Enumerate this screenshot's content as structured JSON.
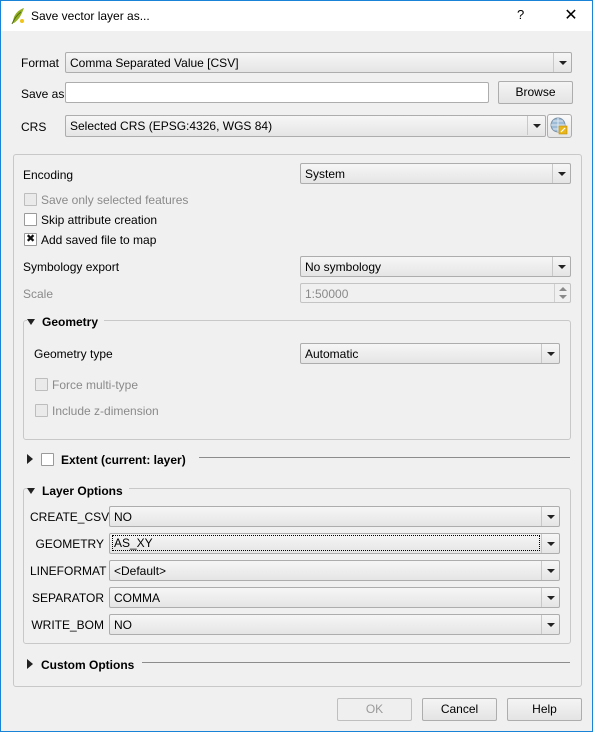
{
  "window": {
    "title": "Save vector layer as...",
    "help_label": "?",
    "close_label": "✕"
  },
  "top": {
    "format_label": "Format",
    "format_value": "Comma Separated Value [CSV]",
    "save_as_label": "Save as",
    "save_as_value": "",
    "browse_label": "Browse",
    "crs_label": "CRS",
    "crs_value": "Selected CRS (EPSG:4326, WGS 84)"
  },
  "options": {
    "encoding_label": "Encoding",
    "encoding_value": "System",
    "save_selected_label": "Save only selected features",
    "save_selected_checked": false,
    "skip_attr_label": "Skip attribute creation",
    "skip_attr_checked": false,
    "add_to_map_label": "Add saved file to map",
    "add_to_map_checked": true,
    "symbology_label": "Symbology export",
    "symbology_value": "No symbology",
    "scale_label": "Scale",
    "scale_value": "1:50000"
  },
  "geometry": {
    "title": "Geometry",
    "type_label": "Geometry type",
    "type_value": "Automatic",
    "force_multi_label": "Force multi-type",
    "include_z_label": "Include z-dimension"
  },
  "extent": {
    "title": "Extent (current: layer)",
    "checked": false
  },
  "layer_options": {
    "title": "Layer Options",
    "rows": [
      {
        "label": "CREATE_CSVT",
        "value": "NO"
      },
      {
        "label": "GEOMETRY",
        "value": "AS_XY"
      },
      {
        "label": "LINEFORMAT",
        "value": "<Default>"
      },
      {
        "label": "SEPARATOR",
        "value": "COMMA"
      },
      {
        "label": "WRITE_BOM",
        "value": "NO"
      }
    ]
  },
  "custom_options": {
    "title": "Custom Options"
  },
  "buttons": {
    "ok": "OK",
    "cancel": "Cancel",
    "help": "Help"
  }
}
